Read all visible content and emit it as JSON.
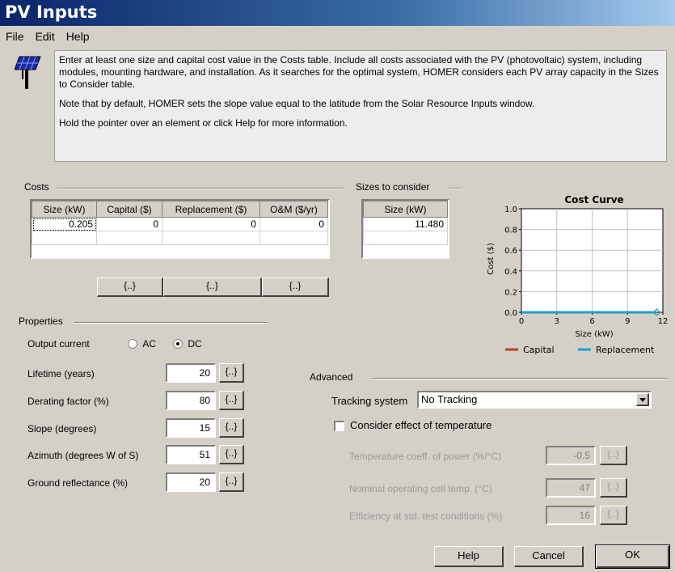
{
  "window": {
    "title": "PV Inputs"
  },
  "menu": [
    "File",
    "Edit",
    "Help"
  ],
  "info": {
    "icon": "solar-panel-icon",
    "p1": "Enter at least one size and capital cost value in the Costs table.  Include all costs associated with the PV (photovoltaic) system, including modules, mounting hardware, and installation. As it searches for the optimal system, HOMER considers each PV array capacity in the Sizes to Consider table.",
    "p2": "Note that by default, HOMER sets the slope value equal to the latitude from the Solar Resource Inputs window.",
    "p3": "Hold the pointer over an element or click Help for more information."
  },
  "costs": {
    "label": "Costs",
    "headers": [
      "Size (kW)",
      "Capital ($)",
      "Replacement ($)",
      "O&M ($/yr)"
    ],
    "rows": [
      [
        "0.205",
        "0",
        "0",
        "0"
      ]
    ],
    "sens_buttons": [
      "{..}",
      "{..}",
      "{..}"
    ]
  },
  "sizes": {
    "label": "Sizes to consider",
    "header": "Size (kW)",
    "values": [
      "11.480"
    ]
  },
  "chart_data": {
    "type": "line",
    "title": "Cost Curve",
    "xlabel": "Size (kW)",
    "ylabel": "Cost ($)",
    "xlim": [
      0,
      12
    ],
    "ylim": [
      0,
      1.0
    ],
    "xticks": [
      "0",
      "3",
      "6",
      "9",
      "12"
    ],
    "yticks": [
      "0.0",
      "0.2",
      "0.4",
      "0.6",
      "0.8",
      "1.0"
    ],
    "grid": true,
    "legend_position": "bottom",
    "series": [
      {
        "name": "Capital",
        "color": "#c0393b",
        "x": [
          0,
          11.48
        ],
        "y": [
          0,
          0
        ]
      },
      {
        "name": "Replacement",
        "color": "#1f9fd0",
        "x": [
          0,
          11.48
        ],
        "y": [
          0,
          0
        ]
      }
    ]
  },
  "properties": {
    "label": "Properties",
    "output_current": {
      "label": "Output current",
      "options": [
        "AC",
        "DC"
      ],
      "selected": "DC"
    },
    "fields": [
      {
        "label": "Lifetime (years)",
        "value": "20",
        "sens": "{..}"
      },
      {
        "label": "Derating factor (%)",
        "value": "80",
        "sens": "{..}"
      },
      {
        "label": "Slope (degrees)",
        "value": "15",
        "sens": "{..}"
      },
      {
        "label": "Azimuth (degrees W of S)",
        "value": "51",
        "sens": "{..}"
      },
      {
        "label": "Ground reflectance (%)",
        "value": "20",
        "sens": "{..}"
      }
    ]
  },
  "advanced": {
    "label": "Advanced",
    "tracking": {
      "label": "Tracking system",
      "value": "No Tracking"
    },
    "temperature": {
      "label": "Consider effect of temperature",
      "checked": false
    },
    "fields": [
      {
        "label": "Temperature coeff. of power (%/°C)",
        "value": "-0.5",
        "sens": "{..}"
      },
      {
        "label": "Nominal operating cell temp. (°C)",
        "value": "47",
        "sens": "{..}"
      },
      {
        "label": "Efficiency at std. test conditions (%)",
        "value": "16",
        "sens": "{..}"
      }
    ]
  },
  "buttons": {
    "help": "Help",
    "cancel": "Cancel",
    "ok": "OK"
  }
}
